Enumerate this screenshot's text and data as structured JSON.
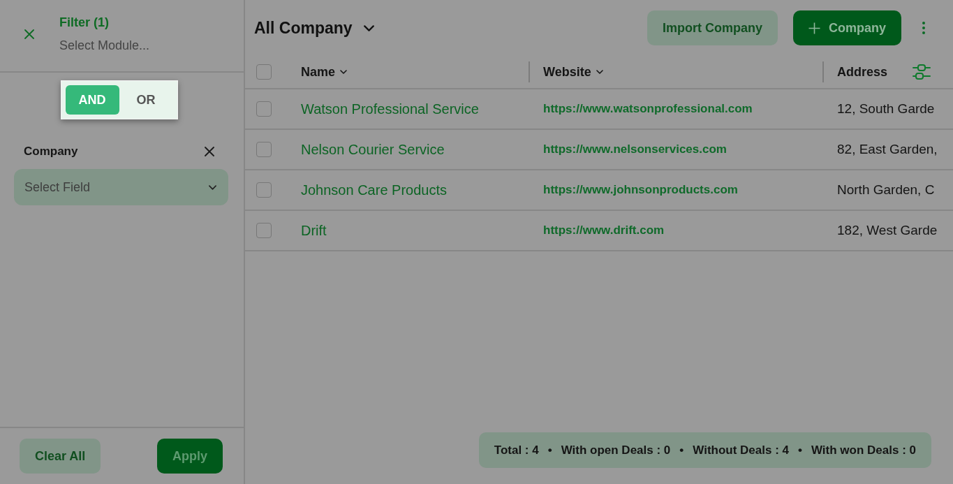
{
  "filter_panel": {
    "title": "Filter (1)",
    "subtitle": "Select Module...",
    "logic_toggle": [
      {
        "label": "AND",
        "selected": true
      },
      {
        "label": "OR",
        "selected": false
      }
    ],
    "conditions": [
      {
        "module": "Company",
        "field": {
          "placeholder": "Select Field"
        }
      }
    ],
    "buttons": [
      {
        "label": "Clear All",
        "kind": "secondary"
      },
      {
        "label": "Apply",
        "kind": "primary"
      }
    ]
  },
  "header": {
    "title": "All Company",
    "buttons": [
      {
        "label": "Import Company",
        "kind": "secondary"
      },
      {
        "label": "Company",
        "kind": "add"
      }
    ]
  },
  "table": {
    "select_all_checked": false,
    "columns": [
      {
        "label": "Name",
        "sortable": true
      },
      {
        "label": "Website",
        "sortable": true
      },
      {
        "label": "Address",
        "sortable": false
      }
    ],
    "rows": [
      {
        "checked": false,
        "name": "Watson Professional Service",
        "website": "https://www.watsonprofessional.com",
        "address": "12, South Garde"
      },
      {
        "checked": false,
        "name": "Nelson Courier Service",
        "website": "https://www.nelsonservices.com",
        "address": "82, East Garden,"
      },
      {
        "checked": false,
        "name": "Johnson Care Products",
        "website": "https://www.johnsonproducts.com",
        "address": "North Garden, C"
      },
      {
        "checked": false,
        "name": "Drift",
        "website": "https://www.drift.com",
        "address": "182, West Garde"
      }
    ]
  },
  "summary": [
    {
      "text": "Total : 4"
    },
    {
      "separator": "•",
      "text": "With open Deals : 0"
    },
    {
      "separator": "•",
      "text": "Without Deals : 4"
    },
    {
      "separator": "•",
      "text": "With won Deals : 0"
    }
  ]
}
